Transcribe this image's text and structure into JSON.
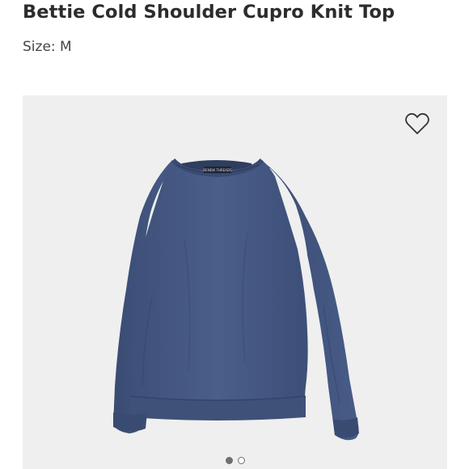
{
  "product": {
    "title": "Bettie Cold Shoulder Cupro Knit Top",
    "size_label": "Size: M",
    "garment_label_text": "RENEW THREADS",
    "garment_color": "#475a85"
  },
  "gallery": {
    "slide_count": 2,
    "active_slide": 1,
    "favorite_icon": "heart-outline-icon"
  },
  "colors": {
    "title": "#2c2c2c",
    "panel_background": "#efefef",
    "garment": "#475a85",
    "garment_shadow": "#34446a"
  }
}
